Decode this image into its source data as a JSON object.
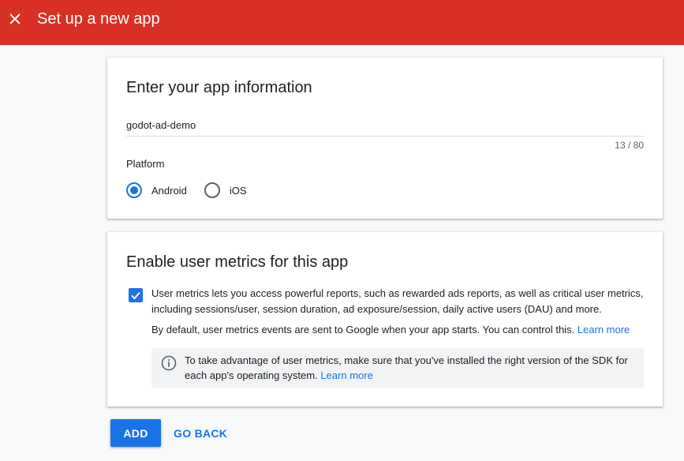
{
  "header": {
    "title": "Set up a new app",
    "close_icon": "close-icon",
    "background_color": "#d93025"
  },
  "app_info": {
    "title": "Enter your app information",
    "name_value": "godot-ad-demo",
    "char_count": "13 / 80",
    "platform_label": "Platform",
    "platforms": [
      {
        "label": "Android",
        "selected": true
      },
      {
        "label": "iOS",
        "selected": false
      }
    ]
  },
  "metrics": {
    "title": "Enable user metrics for this app",
    "checkbox_checked": true,
    "description": "User metrics lets you access powerful reports, such as rewarded ads reports, as well as critical user metrics, including sessions/user, session duration, ad exposure/session, daily active users (DAU) and more.",
    "default_text": "By default, user metrics events are sent to Google when your app starts. You can control this.",
    "default_link": "Learn more",
    "info_icon": "info-icon",
    "info_text": "To take advantage of user metrics, make sure that you've installed the right version of the SDK for each app's operating system.",
    "info_link": "Learn more"
  },
  "actions": {
    "add_label": "ADD",
    "back_label": "GO BACK"
  },
  "colors": {
    "accent": "#1a73e8",
    "header": "#d93025"
  }
}
